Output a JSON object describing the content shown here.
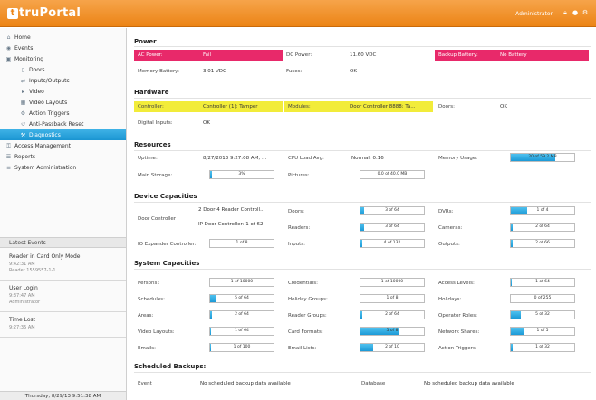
{
  "header": {
    "logo_mark": "t",
    "logo_text": "truPortal",
    "user": "Administrator"
  },
  "icons": [
    "lock-icon",
    "chat-icon",
    "settings-icon"
  ],
  "sidebar": {
    "items": [
      {
        "label": "Home",
        "icon": "home-icon",
        "level": 0
      },
      {
        "label": "Events",
        "icon": "events-icon",
        "level": 0
      },
      {
        "label": "Monitoring",
        "icon": "monitor-icon",
        "level": 0
      },
      {
        "label": "Doors",
        "icon": "door-icon",
        "level": 1
      },
      {
        "label": "Inputs/Outputs",
        "icon": "io-icon",
        "level": 1
      },
      {
        "label": "Video",
        "icon": "video-icon",
        "level": 1
      },
      {
        "label": "Video Layouts",
        "icon": "layout-icon",
        "level": 1
      },
      {
        "label": "Action Triggers",
        "icon": "trigger-icon",
        "level": 1
      },
      {
        "label": "Anti-Passback Reset",
        "icon": "reset-icon",
        "level": 1
      },
      {
        "label": "Diagnostics",
        "icon": "diagnostics-icon",
        "level": 1,
        "active": true
      },
      {
        "label": "Access Management",
        "icon": "access-icon",
        "level": 0
      },
      {
        "label": "Reports",
        "icon": "reports-icon",
        "level": 0
      },
      {
        "label": "System Administration",
        "icon": "admin-icon",
        "level": 0
      }
    ],
    "latest_events_title": "Latest Events",
    "events": [
      {
        "title": "Reader in Card Only Mode",
        "time": "9:42:31 AM",
        "detail": "Reader 1559557-1-1"
      },
      {
        "title": "User Login",
        "time": "9:37:47 AM",
        "detail": "Administrator"
      },
      {
        "title": "Time Lost",
        "time": "9:27:35 AM",
        "detail": ""
      }
    ],
    "footer_date": "Thursday, 8/29/13 9:51:38 AM"
  },
  "sections": {
    "power": "Power",
    "hardware": "Hardware",
    "resources": "Resources",
    "device_capacities": "Device Capacities",
    "system_capacities": "System Capacities",
    "scheduled_backups": "Scheduled Backups:"
  },
  "power": {
    "ac_label": "AC Power:",
    "ac_value": "Fail",
    "dc_label": "DC Power:",
    "dc_value": "11.60 VDC",
    "backup_label": "Backup Battery:",
    "backup_value": "No Battery",
    "mem_label": "Memory Battery:",
    "mem_value": "3.01 VDC",
    "fuses_label": "Fuses:",
    "fuses_value": "OK"
  },
  "hardware": {
    "controller_label": "Controller:",
    "controller_value": "Controller (1): Tamper",
    "modules_label": "Modules:",
    "modules_value": "Door Controller 8888: Ta...",
    "doors_label": "Doors:",
    "doors_value": "OK",
    "digital_label": "Digital Inputs:",
    "digital_value": "OK"
  },
  "resources": {
    "uptime_label": "Uptime:",
    "uptime_value": "8/27/2013 9:27:08 AM; ...",
    "cpu_label": "CPU Load Avg:",
    "cpu_value": "Normal: 0.16",
    "mem_usage_label": "Memory Usage:",
    "mem_usage_text": "20 of 59.2 MB",
    "mem_usage_frac": 0.7,
    "storage_label": "Main Storage:",
    "storage_text": "3%",
    "storage_frac": 0.03,
    "pictures_label": "Pictures:",
    "pictures_text": "0.0 of 40.0 MB",
    "pictures_frac": 0.0
  },
  "device": {
    "door_controller_label": "Door Controller",
    "door_controller_line1": "2 Door 4 Reader Controll...",
    "door_controller_line2": "IP Door Controller: 1 of 62",
    "io_label": "IO Expander Controller:",
    "io_text": "1 of 8",
    "io_frac": 0.0,
    "doors_label": "Doors:",
    "doors_text": "3 of 64",
    "doors_frac": 0.05,
    "readers_label": "Readers:",
    "readers_text": "3 of 64",
    "readers_frac": 0.05,
    "inputs_label": "Inputs:",
    "inputs_text": "4 of 132",
    "inputs_frac": 0.03,
    "dvrs_label": "DVRs:",
    "dvrs_text": "1 of 4",
    "dvrs_frac": 0.25,
    "cameras_label": "Cameras:",
    "cameras_text": "2 of 64",
    "cameras_frac": 0.03,
    "outputs_label": "Outputs:",
    "outputs_text": "2 of 66",
    "outputs_frac": 0.03
  },
  "system": {
    "personsL": "Persons:",
    "personsT": "1 of 10000",
    "personsF": 0.0,
    "schedulesL": "Schedules:",
    "schedulesT": "5 of 64",
    "schedulesF": 0.08,
    "areasL": "Areas:",
    "areasT": "2 of 64",
    "areasF": 0.03,
    "videoL": "Video Layouts:",
    "videoT": "1 of 64",
    "videoF": 0.02,
    "emailsL": "Emails:",
    "emailsT": "1 of 100",
    "emailsF": 0.01,
    "credentialsL": "Credentials:",
    "credentialsT": "1 of 10000",
    "credentialsF": 0.0,
    "holidayGroupsL": "Holiday Groups:",
    "holidayGroupsT": "1 of 8",
    "holidayGroupsF": 0.0,
    "readerGroupsL": "Reader Groups:",
    "readerGroupsT": "2 of 64",
    "readerGroupsF": 0.03,
    "cardFormatsL": "Card Formats:",
    "cardFormatsT": "5 of 8",
    "cardFormatsF": 0.62,
    "emailListsL": "Email Lists:",
    "emailListsT": "2 of 10",
    "emailListsF": 0.2,
    "accessLevelsL": "Access Levels:",
    "accessLevelsT": "1 of 64",
    "accessLevelsF": 0.02,
    "holidaysL": "Holidays:",
    "holidaysT": "0 of 255",
    "holidaysF": 0.0,
    "operatorRolesL": "Operator Roles:",
    "operatorRolesT": "5 of 32",
    "operatorRolesF": 0.16,
    "networkSharesL": "Network Shares:",
    "networkSharesT": "1 of 5",
    "networkSharesF": 0.2,
    "actionTriggersL": "Action Triggers:",
    "actionTriggersT": "1 of 32",
    "actionTriggersF": 0.03
  },
  "backups": {
    "event_label": "Event",
    "event_value": "No scheduled backup data available",
    "db_label": "Database",
    "db_value": "No scheduled backup data available"
  }
}
